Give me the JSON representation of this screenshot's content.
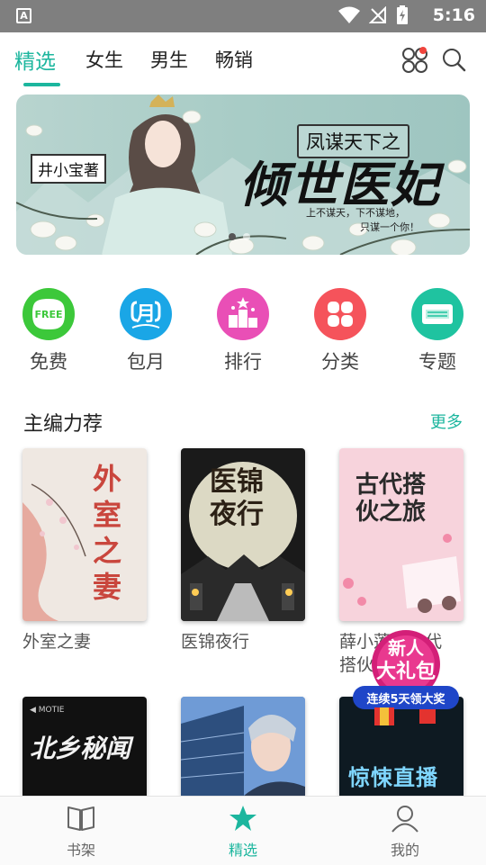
{
  "status": {
    "time": "5:16",
    "app_glyph": "A"
  },
  "nav": {
    "tabs": [
      "精选",
      "女生",
      "男生",
      "畅销"
    ],
    "active_tab": "精选",
    "icons": [
      "apps-icon",
      "search-icon"
    ]
  },
  "banner": {
    "author": "井小宝著",
    "subtitle": "凤谋天下之",
    "title": "倾世医妃",
    "tagline_1": "上不谋天，下不谋地，",
    "tagline_2": "只谋一个你！"
  },
  "categories": [
    {
      "label": "免费",
      "icon": "free-icon",
      "badge": "FREE",
      "color": "#3cc83a"
    },
    {
      "label": "包月",
      "icon": "monthly-icon",
      "badge": "月",
      "color": "#1aa6e6"
    },
    {
      "label": "排行",
      "icon": "ranking-icon",
      "color": "#e94fb6"
    },
    {
      "label": "分类",
      "icon": "category-icon",
      "color": "#f5535b"
    },
    {
      "label": "专题",
      "icon": "topic-icon",
      "color": "#1fc3a0"
    }
  ],
  "section": {
    "title": "主编力荐",
    "more": "更多"
  },
  "books": [
    {
      "title": "外室之妻",
      "cover_text": "外室之妻"
    },
    {
      "title": "医锦夜行",
      "cover_text": "医锦夜行"
    },
    {
      "title": "薛小莲的古代搭伙之旅",
      "title_visible_1": "薛小莲的古代",
      "title_visible_2": "搭伙",
      "cover_text": "古代搭伙之旅"
    },
    {
      "title": "",
      "cover_text": "北乡秘闻"
    },
    {
      "title": "",
      "cover_text": ""
    },
    {
      "title": "",
      "cover_text": "惊悚直播"
    }
  ],
  "promo": {
    "line1": "新人",
    "line2": "大礼包",
    "ribbon": "连续5天领大奖"
  },
  "bottom_nav": [
    {
      "label": "书架",
      "icon": "bookshelf-icon"
    },
    {
      "label": "精选",
      "icon": "star-icon"
    },
    {
      "label": "我的",
      "icon": "profile-icon"
    }
  ],
  "colors": {
    "accent": "#1cb69e",
    "statusbar": "#7f7f7f"
  }
}
